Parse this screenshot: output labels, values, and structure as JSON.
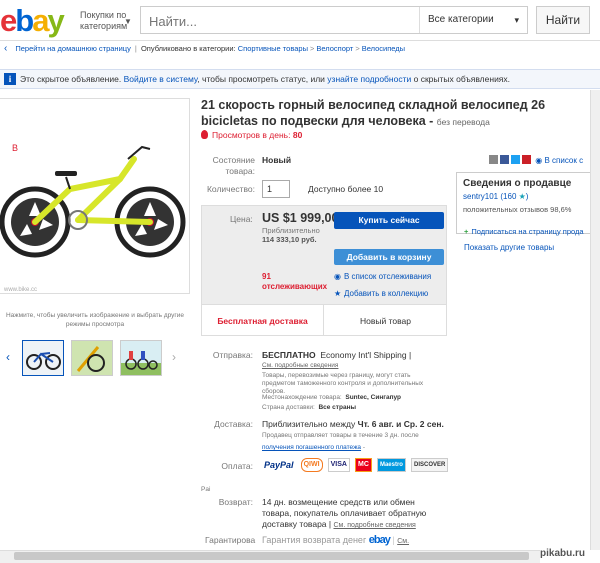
{
  "header": {
    "logo_letters": [
      "e",
      "b",
      "a",
      "y"
    ],
    "logo_colors": [
      "#e53238",
      "#0064d2",
      "#f5af02",
      "#86b817"
    ],
    "category_button": "Покупки по категориям",
    "search_placeholder": "Найти...",
    "search_category": "Все категории",
    "search_button": "Найти"
  },
  "breadcrumb": {
    "back_link": "Перейти на домашнюю страницу",
    "published_in": "Опубликовано в категории:",
    "items": [
      "Спортивные товары",
      "Велоспорт",
      "Велосипеды"
    ]
  },
  "notice": {
    "icon": "i",
    "part1": "Это скрытое объявление.",
    "link1": "Войдите в систему",
    "part2": ", чтобы просмотреть статус, или",
    "link2": "узнайте подробности",
    "part3": "о скрытых объявлениях."
  },
  "gallery": {
    "caption": "Нажмите, чтобы увеличить изображение и выбрать другие режимы просмотра"
  },
  "listing": {
    "title": "21 скорость горный велосипед складной велосипед 26 bicicletas по подвески для человека -",
    "no_translation": "без перевода",
    "views_label": "Просмотров в день:",
    "views_count": "80",
    "condition_label": "Состояние товара:",
    "condition_value": "Новый",
    "quantity_label": "Количество:",
    "quantity_value": "1",
    "availability": "Доступно более 10",
    "price_label": "Цена:",
    "price_value": "US $1 999,00",
    "approx_label": "Приблизительно",
    "approx_value": "114 333,10 руб.",
    "buy_button": "Купить сейчас",
    "cart_button": "Добавить в корзину",
    "watchers_count": "91",
    "watchers_label": "отслеживающих",
    "watch_link": "В список отслеживания",
    "collection_link": "Добавить в коллекцию",
    "free_shipping": "Бесплатная доставка",
    "new_item": "Новый товар"
  },
  "shipping": {
    "label": "Отправка:",
    "free": "БЕСПЛАТНО",
    "method": "Economy Int'l Shipping |",
    "details_link": "См. подробные сведения",
    "note": "Товары, перевозимые через границу, могут стать предметом таможенного контроля и дополнительных сборов.",
    "location_label": "Местонахождение товара:",
    "location_value": "Suntec, Сингапур",
    "countries_label": "Страна доставки:",
    "countries_value": "Все страны"
  },
  "delivery": {
    "label": "Доставка:",
    "text_prefix": "Приблизительно между",
    "dates": "Чт. 6 авг. и Ср. 2 сен.",
    "note": "Продавец отправляет товары в течение 3 дн. после",
    "link": "получения погашенного платежа",
    "link_suffix": "-"
  },
  "payments": {
    "label": "Оплата:",
    "methods": [
      "PayPal",
      "QIWI",
      "VISA",
      "MC",
      "Maestro",
      "DISCOVER"
    ]
  },
  "returns": {
    "small_label": "Pai",
    "label": "Возврат:",
    "text": "14 дн. возмещение средств или обмен товара, покупатель оплачивает обратную доставку товара |",
    "details_link": "См. подробные сведения"
  },
  "guarantee": {
    "label": "Гарантирова",
    "text": "Гарантия возврата денег",
    "brand": "ebay",
    "link": "См."
  },
  "sidebar": {
    "watch_link": "В список с",
    "seller_heading": "Сведения о продавце",
    "seller_name": "sentry101",
    "seller_score": "(160",
    "seller_star": "★",
    "score_close": ")",
    "positive": "положительных отзывов 98,6%",
    "subscribe": "Подписаться на страницу прода",
    "other_items": "Показать другие товары"
  },
  "watermark": "pikabu.ru"
}
